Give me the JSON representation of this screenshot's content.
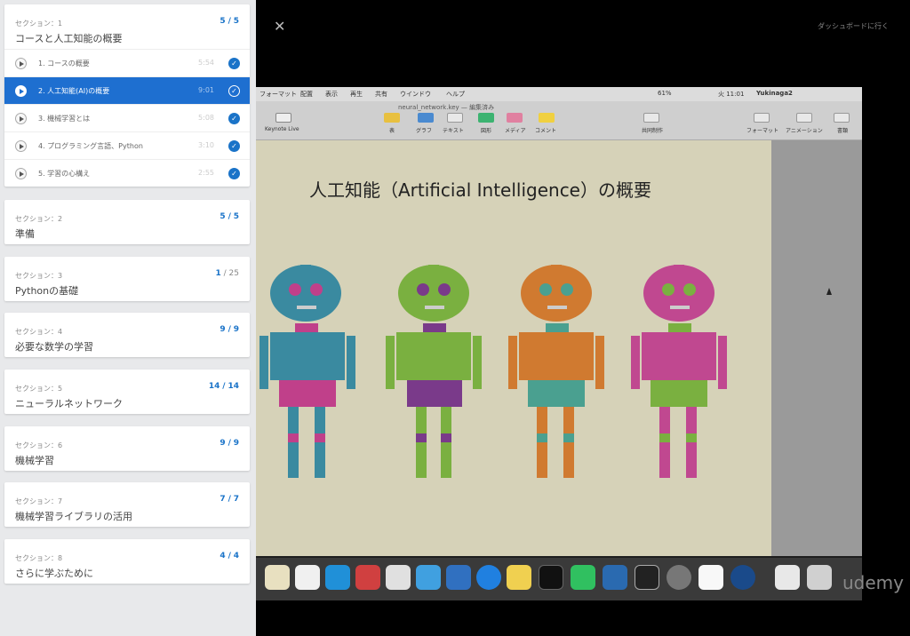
{
  "header": {
    "close_label": "✕",
    "dashboard_label": "ダッシュボードに行く"
  },
  "sections": [
    {
      "num": "セクション：1",
      "title": "コースと人工知能の概要",
      "done": "5",
      "total": "5",
      "lectures": [
        {
          "title": "1. コースの概要",
          "time": "5:54",
          "active": false
        },
        {
          "title": "2. 人工知能(AI)の概要",
          "time": "9:01",
          "active": true
        },
        {
          "title": "3. 機械学習とは",
          "time": "5:08",
          "active": false
        },
        {
          "title": "4. プログラミング言語、Python",
          "time": "3:10",
          "active": false
        },
        {
          "title": "5. 学習の心構え",
          "time": "2:55",
          "active": false
        }
      ]
    },
    {
      "num": "セクション：2",
      "title": "準備",
      "done": "5",
      "total": "5"
    },
    {
      "num": "セクション：3",
      "title": "Pythonの基礎",
      "done": "1",
      "total": "25"
    },
    {
      "num": "セクション：4",
      "title": "必要な数学の学習",
      "done": "9",
      "total": "9"
    },
    {
      "num": "セクション：5",
      "title": "ニューラルネットワーク",
      "done": "14",
      "total": "14"
    },
    {
      "num": "セクション：6",
      "title": "機械学習",
      "done": "9",
      "total": "9"
    },
    {
      "num": "セクション：7",
      "title": "機械学習ライブラリの活用",
      "done": "7",
      "total": "7"
    },
    {
      "num": "セクション：8",
      "title": "さらに学ぶために",
      "done": "4",
      "total": "4"
    }
  ],
  "video": {
    "menubar": {
      "items": [
        "フォーマット",
        "配置",
        "表示",
        "再生",
        "共有",
        "ウインドウ",
        "ヘルプ"
      ],
      "battery": "61%",
      "clock": "火 11:01",
      "user": "Yukinaga2"
    },
    "window_title": "neural_network.key — 編集済み",
    "toolbar": {
      "keynote_live": "Keynote Live",
      "items": [
        "表",
        "グラフ",
        "テキスト",
        "図形",
        "メディア",
        "コメント"
      ],
      "collab": "共同制作",
      "right_items": [
        "フォーマット",
        "アニメーション",
        "書類"
      ]
    },
    "slide_title": "人工知能（Artificial Intelligence）の概要",
    "watermark": "udemy"
  },
  "colors": {
    "accent": "#1e6fd0",
    "check": "#1a73c8"
  }
}
